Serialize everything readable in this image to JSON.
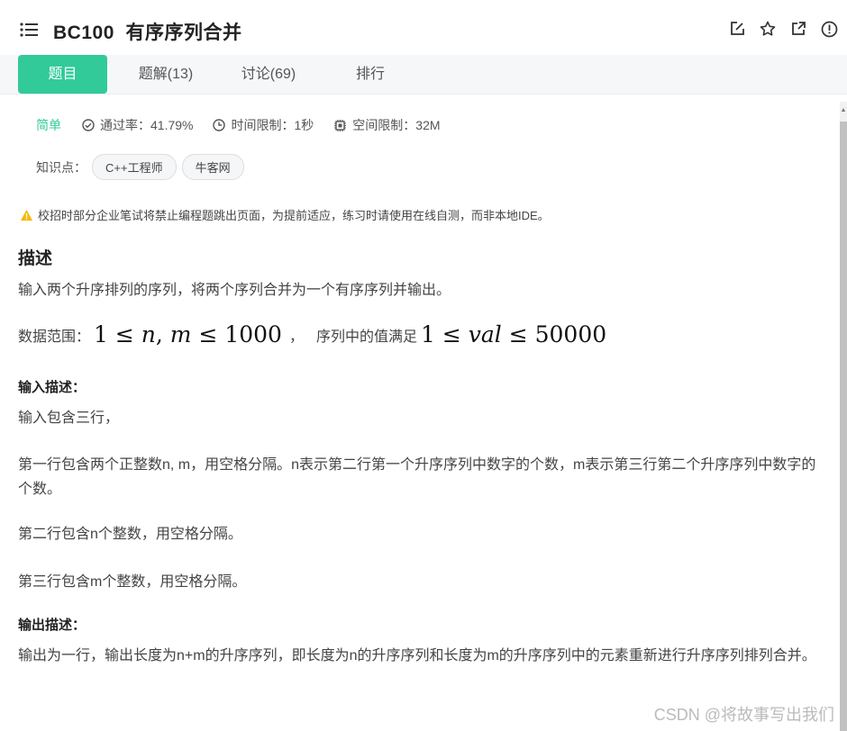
{
  "header": {
    "title": "BC100  有序序列合并",
    "icons": [
      "menu-icon",
      "edit-icon",
      "star-icon",
      "share-icon",
      "report-icon"
    ]
  },
  "tabs": [
    {
      "label": "题目",
      "active": true
    },
    {
      "label": "题解(13)",
      "active": false
    },
    {
      "label": "讨论(69)",
      "active": false
    },
    {
      "label": "排行",
      "active": false
    }
  ],
  "meta": {
    "difficulty": "简单",
    "pass_rate": "通过率：41.79%",
    "time_limit": "时间限制：1秒",
    "space_limit": "空间限制：32M"
  },
  "knowledge": {
    "label": "知识点：",
    "tags": [
      "C++工程师",
      "牛客网"
    ]
  },
  "warning": "校招时部分企业笔试将禁止编程题跳出页面，为提前适应，练习时请使用在线自测，而非本地IDE。",
  "description": {
    "heading": "描述",
    "text": "输入两个升序排列的序列，将两个序列合并为一个有序序列并输出。",
    "range_prefix": "数据范围：",
    "range_math_1": "1 ≤ n,m ≤ 1000",
    "range_sep": "，",
    "range_middle": "序列中的值满足",
    "range_math_2": "1 ≤ val ≤ 50000"
  },
  "input": {
    "heading": "输入描述：",
    "lines": [
      "输入包含三行，",
      "第一行包含两个正整数n, m，用空格分隔。n表示第二行第一个升序序列中数字的个数，m表示第三行第二个升序序列中数字的个数。",
      "第二行包含n个整数，用空格分隔。",
      "第三行包含m个整数，用空格分隔。"
    ]
  },
  "output": {
    "heading": "输出描述：",
    "text": "输出为一行，输出长度为n+m的升序序列，即长度为n的升序序列和长度为m的升序序列中的元素重新进行升序序列排列合并。"
  },
  "watermark": "CSDN @将故事写出我们",
  "colors": {
    "accent": "#32ca99",
    "warning": "#f5b800"
  }
}
